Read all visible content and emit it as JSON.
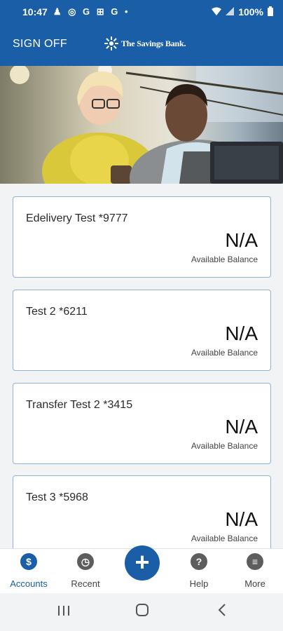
{
  "status_bar": {
    "time": "10:47",
    "notification_glyphs": "♟ ◎ G ⊞ G •",
    "battery": "100%"
  },
  "app_bar": {
    "sign_off_label": "SIGN OFF",
    "logo_text": "The Savings Bank."
  },
  "accounts": [
    {
      "name": "Edelivery Test *9777",
      "balance": "N/A",
      "balance_label": "Available Balance"
    },
    {
      "name": "Test 2 *6211",
      "balance": "N/A",
      "balance_label": "Available Balance"
    },
    {
      "name": "Transfer Test 2 *3415",
      "balance": "N/A",
      "balance_label": "Available Balance"
    },
    {
      "name": "Test 3 *5968",
      "balance": "N/A",
      "balance_label": "Available Balance"
    }
  ],
  "bottom_nav": {
    "accounts": {
      "label": "Accounts",
      "icon": "accounts-icon",
      "glyph": "$"
    },
    "recent": {
      "label": "Recent",
      "icon": "clock-icon",
      "glyph": "◷"
    },
    "add": {
      "icon": "plus-icon",
      "glyph": "+"
    },
    "help": {
      "label": "Help",
      "icon": "help-icon",
      "glyph": "?"
    },
    "more": {
      "label": "More",
      "icon": "more-icon",
      "glyph": "≡"
    }
  },
  "colors": {
    "brand_blue": "#1a5ea8",
    "card_border": "#8fb2d8",
    "background": "#f2f3f5"
  }
}
